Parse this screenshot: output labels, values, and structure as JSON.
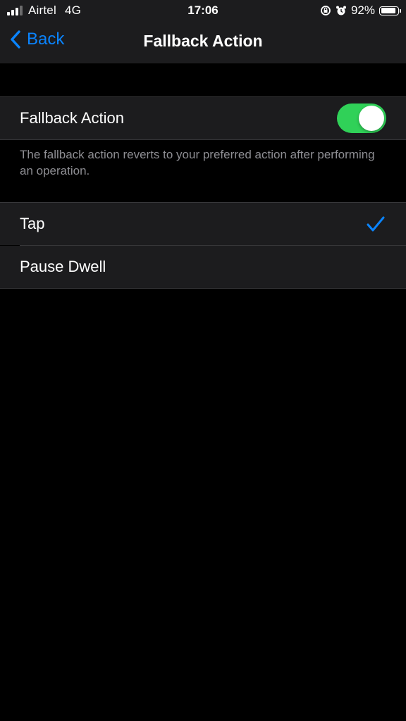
{
  "status_bar": {
    "carrier": "Airtel",
    "network": "4G",
    "time": "17:06",
    "battery_percent_label": "92%",
    "battery_level": 0.92,
    "icons": [
      "signal-bars-icon",
      "rotation-lock-icon",
      "alarm-icon",
      "battery-icon"
    ]
  },
  "nav": {
    "back_label": "Back",
    "title": "Fallback Action"
  },
  "toggle_cell": {
    "label": "Fallback Action",
    "enabled": true
  },
  "footer": {
    "text": "The fallback action reverts to your preferred action after performing an operation."
  },
  "options": [
    {
      "label": "Tap",
      "selected": true
    },
    {
      "label": "Pause Dwell",
      "selected": false
    }
  ],
  "colors": {
    "background": "#000000",
    "cell_background": "#1c1c1e",
    "accent_blue": "#0a84ff",
    "toggle_on_green": "#30d158",
    "secondary_text": "#8e8e93",
    "separator": "#38383a"
  }
}
